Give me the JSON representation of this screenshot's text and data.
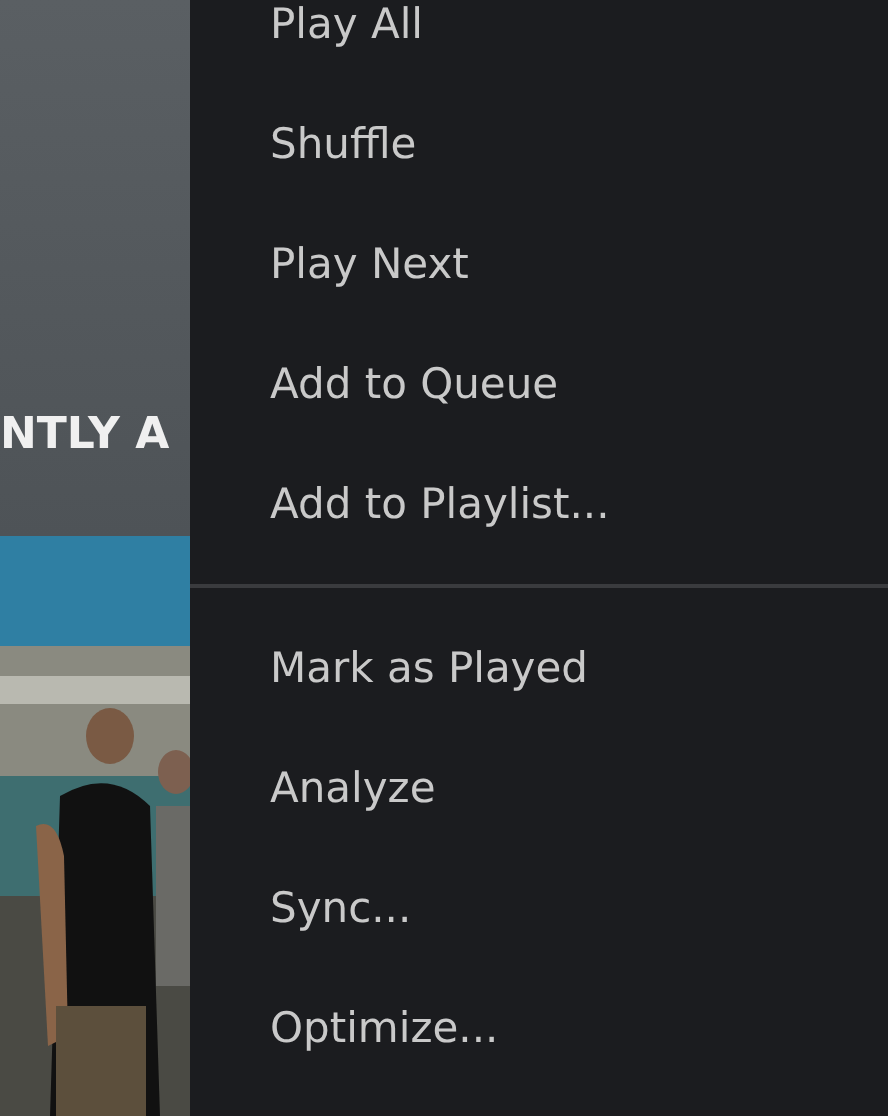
{
  "section": {
    "heading": "NTLY A"
  },
  "menu": {
    "groups": [
      {
        "items": [
          {
            "label": "Play All"
          },
          {
            "label": "Shuffle"
          },
          {
            "label": "Play Next"
          },
          {
            "label": "Add to Queue"
          },
          {
            "label": "Add to Playlist..."
          }
        ]
      },
      {
        "items": [
          {
            "label": "Mark as Played"
          },
          {
            "label": "Analyze"
          },
          {
            "label": "Sync..."
          },
          {
            "label": "Optimize..."
          }
        ]
      }
    ]
  }
}
